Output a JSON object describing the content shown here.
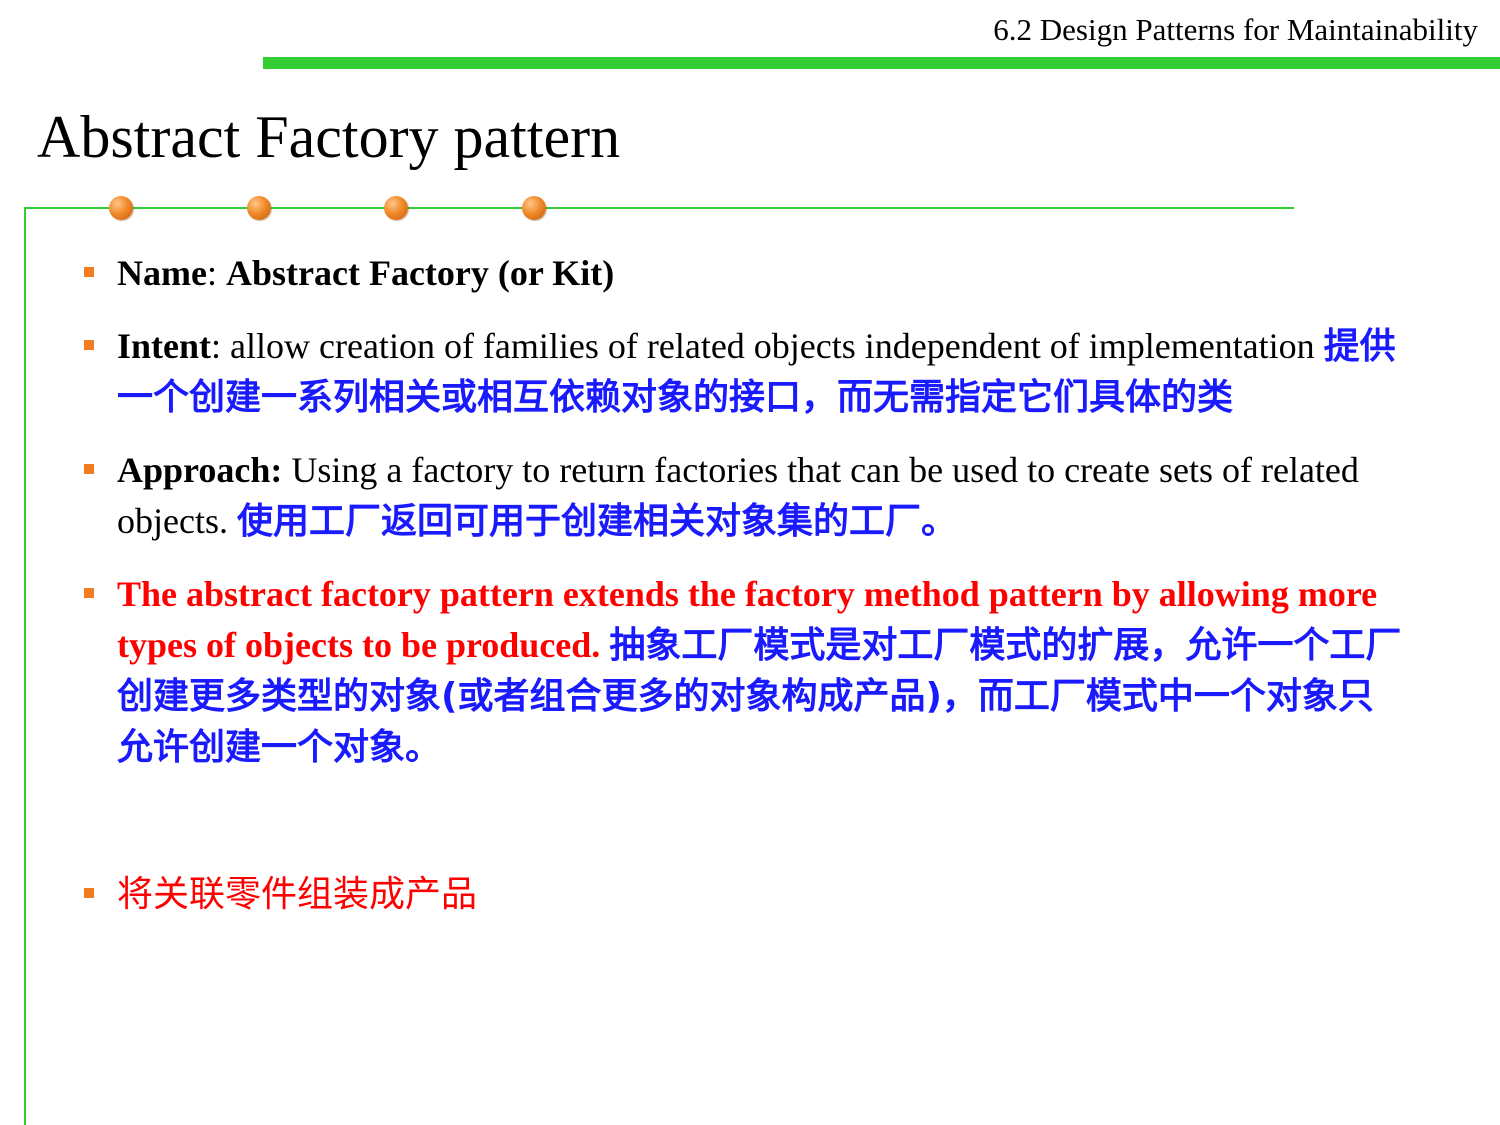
{
  "header": {
    "title": "6.2 Design Patterns for Maintainability"
  },
  "slide": {
    "title": "Abstract Factory pattern"
  },
  "colors": {
    "accent_green": "#33cc33",
    "bullet_orange": "#f47c20",
    "chinese_blue": "#1a1aff",
    "emphasis_red": "#ff0000"
  },
  "bullets": [
    {
      "label": "Name",
      "separator": ": ",
      "value": "Abstract Factory (or Kit)"
    },
    {
      "label": "Intent",
      "separator": ": ",
      "text": "allow creation of families of related objects independent of implementation ",
      "translation": "提供一个创建一系列相关或相互依赖对象的接口，而无需指定它们具体的类"
    },
    {
      "label": "Approach:",
      "text": " Using a factory to  return factories that can be used to create sets of related objects. ",
      "translation": "使用工厂返回可用于创建相关对象集的工厂。"
    },
    {
      "text": "The abstract factory pattern extends the factory method pattern by allowing more types of objects to be produced. ",
      "translation": "抽象工厂模式是对工厂模式的扩展，允许一个工厂创建更多类型的对象(或者组合更多的对象构成产品)，而工厂模式中一个对象只允许创建一个对象。"
    },
    {
      "text": "将关联零件组装成产品"
    }
  ]
}
